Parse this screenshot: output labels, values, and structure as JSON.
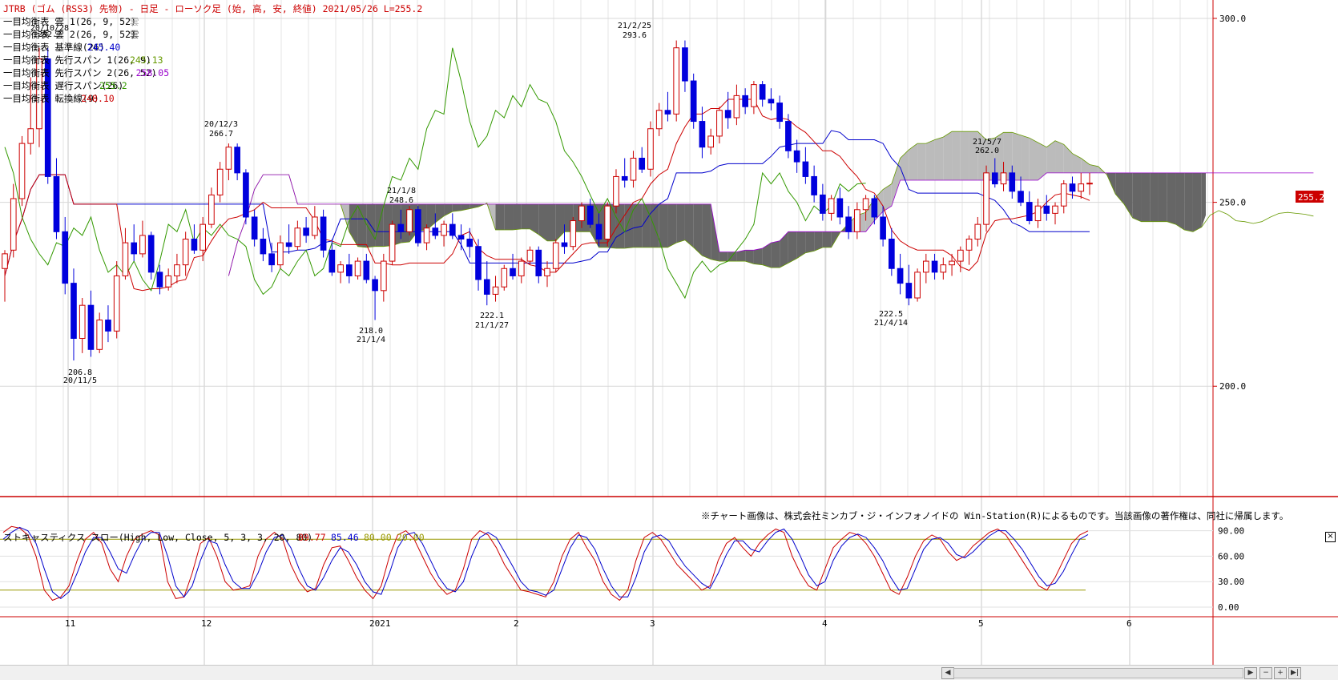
{
  "title": "JTRB (ゴム (RSS3) 先物) - 日足 - ローソク足 (始, 高, 安, 終値)  2021/05/26  L=255.2",
  "legend": [
    {
      "label": "一目均衡表 雲 1(26, 9, 52)",
      "value": "雲",
      "color": "#aaaaaa"
    },
    {
      "label": "一目均衡表 雲 2(26, 9, 52)",
      "value": "雲",
      "color": "#555555"
    },
    {
      "label": "一目均衡表 基準線(26)",
      "value": "245.40",
      "color": "#0000cc"
    },
    {
      "label": "一目均衡表 先行スパン 1(26, 9)",
      "value": "245.13",
      "color": "#669900"
    },
    {
      "label": "一目均衡表 先行スパン 2(26, 52)",
      "value": "258.05",
      "color": "#9900cc"
    },
    {
      "label": "一目均衡表 遅行スパン(26)",
      "value": "255.2",
      "color": "#339900"
    },
    {
      "label": "一目均衡表 転換線(9)",
      "value": "248.10",
      "color": "#cc0000"
    }
  ],
  "annotations": [
    {
      "date": "20/10/28",
      "price": "292.?"
    },
    {
      "date": "20/11/5",
      "price": "206.8"
    },
    {
      "date": "20/12/3",
      "price": "266.7"
    },
    {
      "date": "21/1/4",
      "price": "218.0"
    },
    {
      "date": "21/1/8",
      "price": "248.6"
    },
    {
      "date": "21/1/27",
      "price": "222.1"
    },
    {
      "date": "21/2/25",
      "price": "293.6"
    },
    {
      "date": "21/4/14",
      "price": "222.5"
    },
    {
      "date": "21/5/7",
      "price": "262.0"
    }
  ],
  "last_price_label": "255.2",
  "copyright": "※チャート画像は、株式会社ミンカブ・ジ・インフォノイドの Win-Station(R)によるものです。当該画像の著作権は、同社に帰属します。",
  "stochastic": {
    "label": "ストキャスティクス スロー(High, Low, Close, 5, 3, 3, 20, 80)",
    "values": [
      {
        "text": "89.77",
        "color": "#cc0000"
      },
      {
        "text": "85.46",
        "color": "#0000cc"
      },
      {
        "text": "80.00",
        "color": "#999900"
      },
      {
        "text": "20.00",
        "color": "#999900"
      }
    ],
    "ticks": [
      "90.00",
      "60.00",
      "30.00",
      "0.00"
    ],
    "close_label": "×"
  },
  "x_labels": [
    "11",
    "12",
    "2021",
    "2",
    "3",
    "4",
    "5",
    "6"
  ],
  "colors": {
    "up": "#cc0000",
    "down": "#0000dd",
    "cloud_up": "#bbbbbb",
    "cloud_down": "#666666",
    "kijun": "#0000cc",
    "tenkan": "#cc0000",
    "chikou": "#339900"
  },
  "chart_data": [
    {
      "type": "candlestick",
      "title": "JTRB (ゴム (RSS3) 先物) - 日足 - ローソク足 (始, 高, 安, 終値)",
      "ylim": [
        170,
        305
      ],
      "y_ticks": [
        300.0,
        250.0,
        200.0
      ],
      "x_ticks": [
        "11",
        "12",
        "2021",
        "2",
        "3",
        "4",
        "5",
        "6"
      ],
      "high_low_labels": [
        {
          "date": "20/11/5",
          "value": 206.8
        },
        {
          "date": "20/12/3",
          "value": 266.7
        },
        {
          "date": "21/1/4",
          "value": 218.0
        },
        {
          "date": "21/1/8",
          "value": 248.6
        },
        {
          "date": "21/1/27",
          "value": 222.1
        },
        {
          "date": "21/2/25",
          "value": 293.6
        },
        {
          "date": "21/4/14",
          "value": 222.5
        },
        {
          "date": "21/5/7",
          "value": 262.0
        }
      ],
      "last_value": 255.2,
      "series_ohlc_note": "approximate daily OHLC, 2020-10 to 2021-05-26",
      "ohlc": [
        [
          232,
          237,
          223,
          236
        ],
        [
          237,
          255,
          235,
          251
        ],
        [
          251,
          268,
          249,
          266
        ],
        [
          266,
          284,
          263,
          270
        ],
        [
          270,
          292,
          265,
          289
        ],
        [
          289,
          292,
          255,
          257
        ],
        [
          257,
          262,
          240,
          242
        ],
        [
          242,
          246,
          225,
          228
        ],
        [
          228,
          232,
          207,
          213
        ],
        [
          213,
          224,
          209,
          222
        ],
        [
          222,
          226,
          208,
          210
        ],
        [
          210,
          220,
          209,
          218
        ],
        [
          218,
          222,
          212,
          215
        ],
        [
          215,
          234,
          213,
          230
        ],
        [
          230,
          243,
          229,
          239
        ],
        [
          239,
          244,
          234,
          236
        ],
        [
          236,
          245,
          235,
          241
        ],
        [
          241,
          242,
          229,
          231
        ],
        [
          231,
          233,
          225,
          227
        ],
        [
          227,
          232,
          226,
          230
        ],
        [
          230,
          236,
          228,
          233
        ],
        [
          233,
          242,
          230,
          240
        ],
        [
          240,
          244,
          236,
          237
        ],
        [
          237,
          246,
          234,
          244
        ],
        [
          244,
          254,
          243,
          252
        ],
        [
          252,
          261,
          250,
          259
        ],
        [
          259,
          266,
          256,
          265
        ],
        [
          265,
          266,
          256,
          258
        ],
        [
          258,
          259,
          244,
          246
        ],
        [
          246,
          248,
          238,
          240
        ],
        [
          240,
          243,
          234,
          236
        ],
        [
          236,
          239,
          231,
          233
        ],
        [
          233,
          241,
          232,
          239
        ],
        [
          239,
          244,
          236,
          238
        ],
        [
          238,
          245,
          237,
          243
        ],
        [
          243,
          246,
          239,
          241
        ],
        [
          241,
          249,
          240,
          246
        ],
        [
          246,
          248,
          235,
          237
        ],
        [
          237,
          240,
          230,
          231
        ],
        [
          231,
          234,
          228,
          233
        ],
        [
          233,
          236,
          228,
          230
        ],
        [
          230,
          235,
          229,
          234
        ],
        [
          234,
          236,
          228,
          229
        ],
        [
          229,
          230,
          218,
          226
        ],
        [
          226,
          236,
          223,
          234
        ],
        [
          234,
          245,
          233,
          244
        ],
        [
          244,
          248,
          240,
          242
        ],
        [
          242,
          249,
          241,
          248
        ],
        [
          248,
          249,
          238,
          239
        ],
        [
          239,
          244,
          237,
          243
        ],
        [
          243,
          247,
          240,
          241
        ],
        [
          241,
          245,
          238,
          244
        ],
        [
          244,
          247,
          240,
          241
        ],
        [
          241,
          244,
          237,
          240
        ],
        [
          240,
          243,
          235,
          238
        ],
        [
          238,
          240,
          226,
          229
        ],
        [
          229,
          234,
          222,
          225
        ],
        [
          225,
          230,
          223,
          227
        ],
        [
          227,
          233,
          226,
          232
        ],
        [
          232,
          236,
          229,
          230
        ],
        [
          230,
          235,
          228,
          234
        ],
        [
          234,
          238,
          233,
          237
        ],
        [
          237,
          238,
          228,
          230
        ],
        [
          230,
          234,
          227,
          232
        ],
        [
          232,
          240,
          231,
          239
        ],
        [
          239,
          244,
          236,
          238
        ],
        [
          238,
          246,
          237,
          245
        ],
        [
          245,
          250,
          243,
          249
        ],
        [
          249,
          251,
          243,
          244
        ],
        [
          244,
          247,
          238,
          240
        ],
        [
          240,
          250,
          238,
          249
        ],
        [
          249,
          259,
          247,
          257
        ],
        [
          257,
          262,
          254,
          256
        ],
        [
          256,
          264,
          254,
          262
        ],
        [
          262,
          265,
          258,
          259
        ],
        [
          259,
          272,
          257,
          270
        ],
        [
          270,
          277,
          268,
          275
        ],
        [
          275,
          280,
          272,
          274
        ],
        [
          274,
          294,
          272,
          292
        ],
        [
          292,
          294,
          280,
          283
        ],
        [
          283,
          285,
          270,
          272
        ],
        [
          272,
          276,
          262,
          265
        ],
        [
          265,
          270,
          263,
          268
        ],
        [
          268,
          276,
          266,
          275
        ],
        [
          275,
          280,
          270,
          273
        ],
        [
          273,
          282,
          271,
          279
        ],
        [
          279,
          281,
          274,
          276
        ],
        [
          276,
          283,
          274,
          282
        ],
        [
          282,
          283,
          276,
          278
        ],
        [
          278,
          281,
          275,
          277
        ],
        [
          277,
          279,
          270,
          272
        ],
        [
          272,
          274,
          262,
          264
        ],
        [
          264,
          267,
          258,
          261
        ],
        [
          261,
          265,
          255,
          257
        ],
        [
          257,
          260,
          250,
          252
        ],
        [
          252,
          255,
          245,
          247
        ],
        [
          247,
          252,
          245,
          251
        ],
        [
          251,
          254,
          244,
          246
        ],
        [
          246,
          249,
          240,
          242
        ],
        [
          242,
          250,
          240,
          248
        ],
        [
          248,
          252,
          245,
          251
        ],
        [
          251,
          252,
          244,
          246
        ],
        [
          246,
          249,
          238,
          240
        ],
        [
          240,
          243,
          230,
          232
        ],
        [
          232,
          236,
          225,
          228
        ],
        [
          228,
          233,
          222,
          224
        ],
        [
          224,
          232,
          223,
          231
        ],
        [
          231,
          236,
          228,
          234
        ],
        [
          234,
          236,
          229,
          231
        ],
        [
          231,
          235,
          229,
          233
        ],
        [
          233,
          236,
          230,
          234
        ],
        [
          234,
          238,
          231,
          237
        ],
        [
          237,
          241,
          233,
          240
        ],
        [
          240,
          246,
          238,
          244
        ],
        [
          244,
          260,
          242,
          258
        ],
        [
          258,
          262,
          254,
          255
        ],
        [
          255,
          261,
          253,
          258
        ],
        [
          258,
          260,
          251,
          253
        ],
        [
          253,
          257,
          249,
          250
        ],
        [
          250,
          253,
          244,
          245
        ],
        [
          245,
          251,
          243,
          249
        ],
        [
          249,
          252,
          245,
          247
        ],
        [
          247,
          250,
          244,
          249
        ],
        [
          249,
          256,
          247,
          255
        ],
        [
          255,
          257,
          251,
          253
        ],
        [
          253,
          258,
          251,
          255
        ],
        [
          255,
          258,
          252,
          255.2
        ]
      ]
    },
    {
      "type": "line",
      "title": "ストキャスティクス スロー(High, Low, Close, 5, 3, 3, 20, 80)",
      "ylim": [
        0,
        100
      ],
      "y_ticks": [
        90,
        60,
        30,
        0
      ],
      "reference_lines": [
        80,
        20
      ],
      "series": [
        {
          "name": "%K",
          "color": "#cc0000",
          "last": 89.77,
          "values": [
            88,
            95,
            93,
            85,
            60,
            20,
            8,
            12,
            25,
            55,
            80,
            88,
            75,
            45,
            30,
            60,
            80,
            86,
            90,
            85,
            30,
            10,
            12,
            40,
            75,
            82,
            60,
            30,
            20,
            22,
            25,
            60,
            80,
            88,
            80,
            50,
            30,
            18,
            22,
            50,
            70,
            72,
            55,
            35,
            20,
            10,
            25,
            60,
            85,
            90,
            80,
            60,
            40,
            25,
            15,
            20,
            45,
            80,
            90,
            85,
            70,
            50,
            35,
            20,
            18,
            15,
            12,
            30,
            60,
            80,
            88,
            70,
            55,
            30,
            15,
            8,
            20,
            55,
            82,
            88,
            80,
            65,
            50,
            40,
            30,
            20,
            25,
            55,
            75,
            82,
            70,
            60,
            75,
            85,
            92,
            88,
            60,
            40,
            25,
            20,
            45,
            70,
            80,
            88,
            85,
            75,
            60,
            40,
            20,
            15,
            35,
            60,
            78,
            85,
            80,
            65,
            55,
            60,
            72,
            80,
            88,
            92,
            85,
            70,
            55,
            40,
            25,
            20,
            35,
            55,
            75,
            85,
            89.77
          ]
        },
        {
          "name": "%D",
          "color": "#0000cc",
          "last": 85.46,
          "values": [
            80,
            88,
            94,
            90,
            75,
            45,
            18,
            10,
            18,
            40,
            65,
            82,
            82,
            65,
            45,
            40,
            62,
            80,
            88,
            88,
            60,
            25,
            12,
            25,
            55,
            78,
            75,
            50,
            30,
            22,
            22,
            40,
            65,
            82,
            85,
            70,
            45,
            25,
            20,
            35,
            55,
            70,
            65,
            50,
            30,
            18,
            15,
            40,
            70,
            85,
            88,
            75,
            55,
            35,
            22,
            18,
            30,
            60,
            82,
            88,
            82,
            65,
            48,
            30,
            20,
            18,
            14,
            20,
            45,
            70,
            85,
            82,
            68,
            45,
            25,
            12,
            12,
            35,
            65,
            82,
            85,
            78,
            62,
            48,
            38,
            28,
            22,
            40,
            62,
            78,
            78,
            68,
            65,
            78,
            88,
            92,
            80,
            60,
            38,
            25,
            30,
            55,
            72,
            82,
            86,
            82,
            70,
            55,
            35,
            20,
            22,
            45,
            68,
            80,
            82,
            75,
            62,
            58,
            65,
            75,
            84,
            90,
            90,
            80,
            68,
            52,
            36,
            25,
            28,
            42,
            62,
            80,
            85.46
          ]
        }
      ]
    }
  ]
}
